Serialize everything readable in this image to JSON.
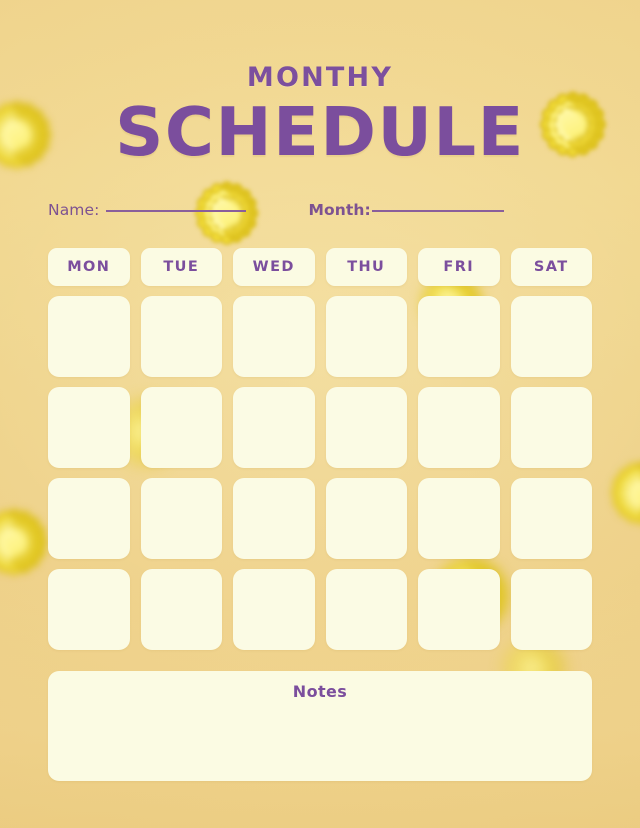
{
  "page": {
    "subtitle": "MONTHY",
    "title": "SCHEDULE",
    "background_color": "#eed289",
    "accent_purple": "#7b4e9d",
    "card_cream": "#fbfbe3"
  },
  "fields": {
    "name_label": "Name:",
    "name_value": "",
    "name_placeholder": "",
    "month_label": "Month:",
    "month_value": "",
    "month_placeholder": ""
  },
  "calendar": {
    "day_headers": [
      "MON",
      "TUE",
      "WED",
      "THU",
      "FRI",
      "SAT"
    ],
    "weeks": [
      {
        "cells": [
          "",
          "",
          "",
          "",
          "",
          ""
        ]
      },
      {
        "cells": [
          "",
          "",
          "",
          "",
          "",
          ""
        ]
      },
      {
        "cells": [
          "",
          "",
          "",
          "",
          "",
          ""
        ]
      },
      {
        "cells": [
          "",
          "",
          "",
          "",
          "",
          ""
        ]
      }
    ]
  },
  "notes": {
    "title": "Notes",
    "content": "",
    "placeholder": ""
  },
  "decor": {
    "flower_top_left": "chrysanthemum-flower",
    "flower_top_right": "chrysanthemum-flower",
    "flower_center_top": "chrysanthemum-flower",
    "flower_left_middle": "chrysanthemum-flower",
    "flower_right_middle": "chrysanthemum-flower",
    "flower_grid_upper": "chrysanthemum-flower",
    "flower_grid_lower": "chrysanthemum-flower",
    "petal_color": "#f7e23f",
    "petal_color_light": "#fdf27e",
    "center_color": "#7f9a22"
  }
}
